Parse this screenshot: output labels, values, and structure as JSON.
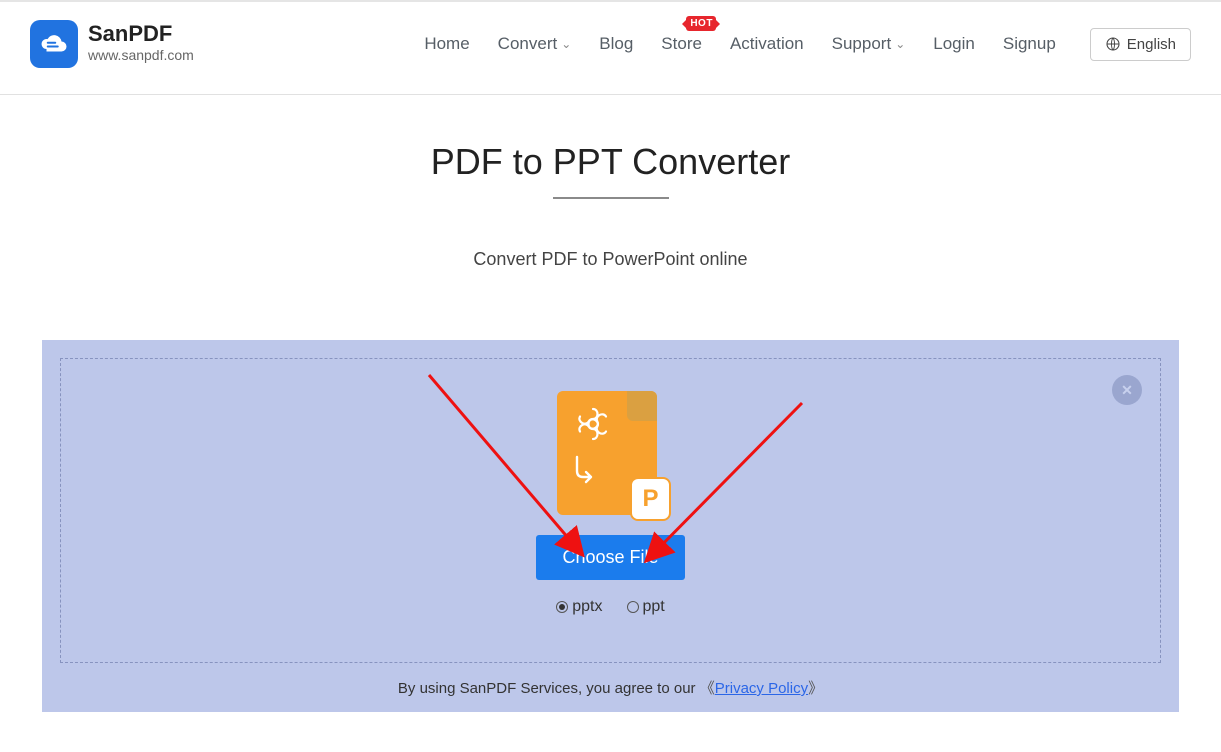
{
  "brand": {
    "title": "SanPDF",
    "subtitle": "www.sanpdf.com"
  },
  "nav": {
    "home": "Home",
    "convert": "Convert",
    "blog": "Blog",
    "store": "Store",
    "store_badge": "HOT",
    "activation": "Activation",
    "support": "Support",
    "login": "Login",
    "signup": "Signup"
  },
  "lang": {
    "label": "English"
  },
  "page": {
    "title": "PDF to PPT Converter",
    "subtitle": "Convert PDF to PowerPoint online",
    "choose": "Choose File",
    "radio_pptx": "pptx",
    "radio_ppt": "ppt",
    "agree_prefix": "By using SanPDF Services, you agree to our ",
    "policy": "Privacy Policy",
    "open_br": "《",
    "close_br": "》"
  }
}
